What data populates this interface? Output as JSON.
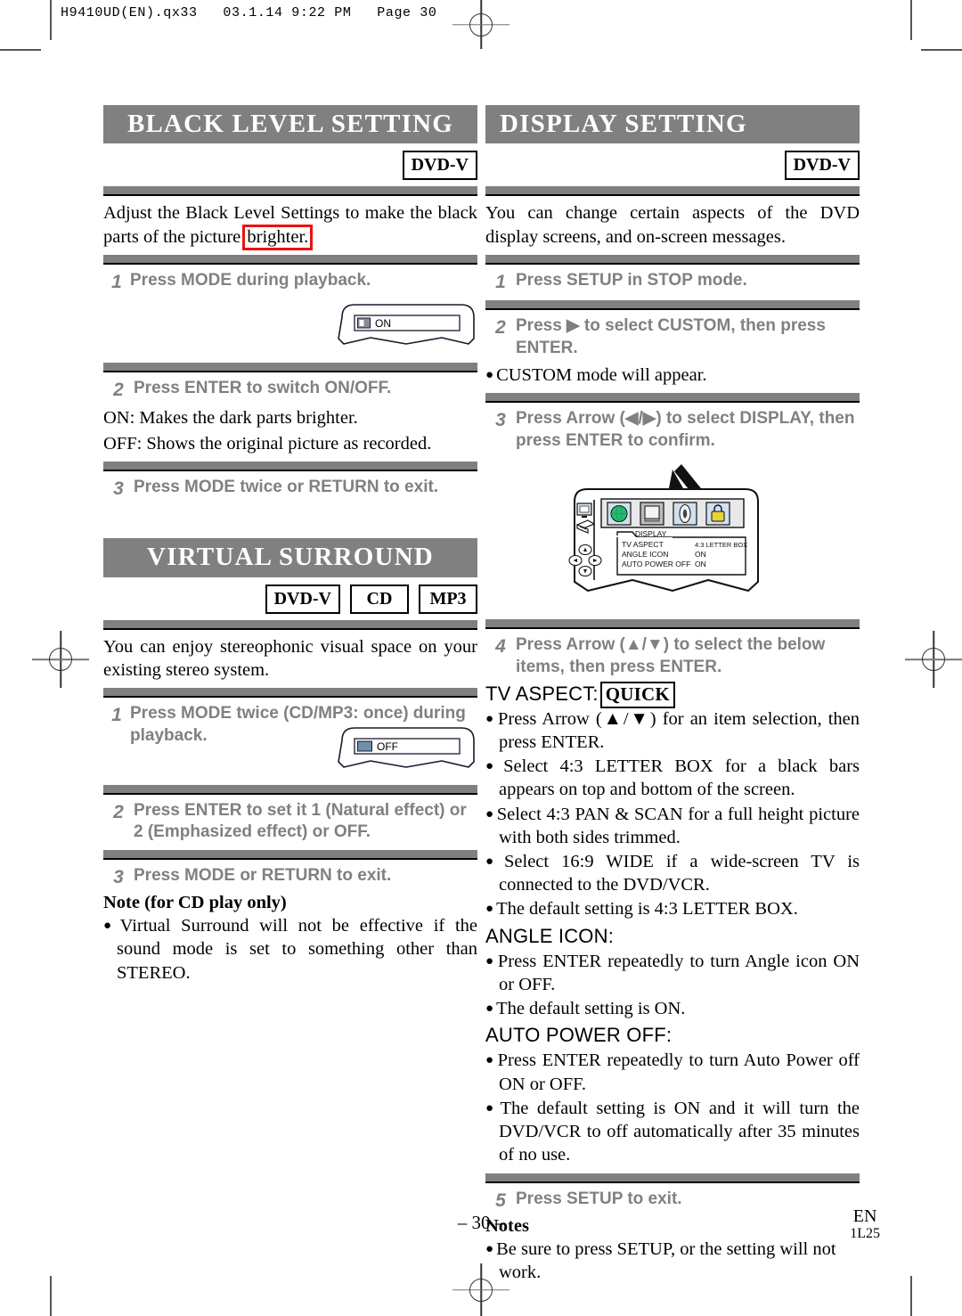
{
  "prepress": {
    "slug": "H9410UD(EN).qx33   03.1.14 9:22 PM   Page 30"
  },
  "left_column": {
    "section1": {
      "title": "BLACK LEVEL SETTING",
      "badges": [
        "DVD-V"
      ],
      "intro_before": "Adjust the Black Level Settings to make the black parts of the picture ",
      "intro_highlight": "brighter.",
      "highlight_color": "#ee1111",
      "steps": [
        {
          "num": "1",
          "text": "Press MODE during playback."
        },
        {
          "num": "2",
          "text": "Press ENTER to switch ON/OFF."
        },
        {
          "num": "3",
          "text": "Press MODE twice or RETURN to exit."
        }
      ],
      "osd_label": "ON",
      "after_step2_lines": [
        "ON: Makes the dark parts brighter.",
        "OFF: Shows the original picture as recorded."
      ]
    },
    "section2": {
      "title": "VIRTUAL SURROUND",
      "badges": [
        "DVD-V",
        "CD",
        "MP3"
      ],
      "intro": "You can enjoy stereophonic visual space on your existing stereo system.",
      "steps": [
        {
          "num": "1",
          "text": "Press MODE twice (CD/MP3: once) during playback."
        },
        {
          "num": "2",
          "text": "Press ENTER to set it 1 (Natural effect) or 2 (Emphasized effect) or OFF."
        },
        {
          "num": "3",
          "text": "Press MODE or RETURN to exit."
        }
      ],
      "osd_label": "OFF",
      "note_head": "Note (for CD play only)",
      "note_bullets": [
        "Virtual Surround will not be effective if the sound mode is set to something other than STEREO."
      ]
    }
  },
  "right_column": {
    "section1": {
      "title": "DISPLAY SETTING",
      "badges": [
        "DVD-V"
      ],
      "intro": "You can change certain aspects of the DVD display screens, and on-screen messages.",
      "steps": [
        {
          "num": "1",
          "text": "Press SETUP in STOP mode."
        },
        {
          "num": "2",
          "text": "Press ▶ to select CUSTOM, then press ENTER."
        },
        {
          "num": "3",
          "text": "Press Arrow (◀/▶) to select DISPLAY, then press ENTER to confirm."
        },
        {
          "num": "4",
          "text": "Press Arrow (▲/▼) to select the below items, then press ENTER."
        },
        {
          "num": "5",
          "text": "Press SETUP to exit."
        }
      ],
      "after_step2_bullet": "CUSTOM mode will appear.",
      "osd_figure": {
        "menu_title": "DISPLAY",
        "rows": [
          {
            "label": "TV ASPECT",
            "value": "4:3 LETTER BOX"
          },
          {
            "label": "ANGLE ICON",
            "value": "ON"
          },
          {
            "label": "AUTO POWER OFF",
            "value": "ON"
          }
        ],
        "icons": [
          "globe-icon",
          "display-icon",
          "audio-icon",
          "lock-icon"
        ]
      },
      "items": [
        {
          "heading": "TV ASPECT:",
          "heading_boxed": "QUICK",
          "bullets": [
            "Press Arrow (▲/▼) for an item selection, then press ENTER.",
            "Select 4:3 LETTER BOX for a black bars appears on top and bottom of the screen.",
            "Select 4:3 PAN & SCAN for a full height picture with both sides trimmed.",
            "Select 16:9 WIDE if a wide-screen TV is connected to the DVD/VCR.",
            "The default setting is 4:3 LETTER BOX."
          ]
        },
        {
          "heading": "ANGLE ICON:",
          "heading_boxed": "",
          "bullets": [
            "Press ENTER repeatedly to turn Angle icon ON or OFF.",
            "The default setting is ON."
          ]
        },
        {
          "heading": "AUTO POWER OFF:",
          "heading_boxed": "",
          "bullets": [
            "Press ENTER repeatedly to turn Auto Power off ON or OFF.",
            "The default setting is ON and it will turn the DVD/VCR to off automatically after 35 minutes of no use."
          ]
        }
      ],
      "notes_head": "Notes",
      "notes_bullets": [
        "Be sure to press SETUP, or the setting will not work."
      ]
    }
  },
  "footer": {
    "page_number": "– 30 –",
    "language": "EN",
    "doc_code": "1L25"
  },
  "colors": {
    "header_gray": "#808080",
    "step_gray": "#808080",
    "highlight_red": "#ee1111"
  }
}
